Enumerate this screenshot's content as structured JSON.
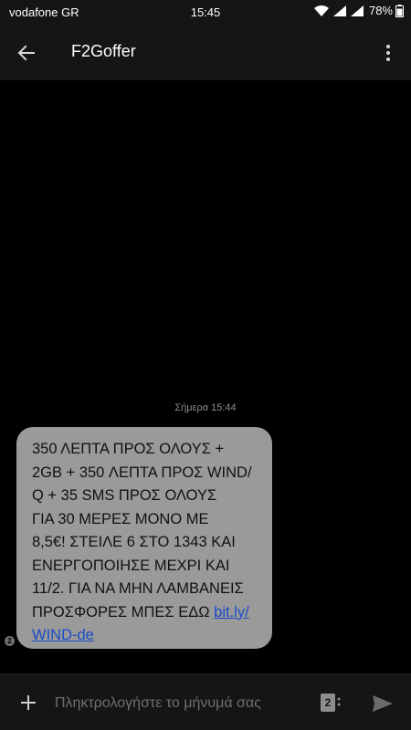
{
  "status_bar": {
    "carrier": "vodafone GR",
    "time": "15:45",
    "battery": "78%",
    "icons": [
      "wifi-icon",
      "signal-icon",
      "signal-icon",
      "battery-icon"
    ]
  },
  "app_bar": {
    "title": "F2Goffer",
    "back_icon": "back-arrow-icon",
    "menu_icon": "overflow-menu-icon"
  },
  "conversation": {
    "timestamp": "Σήμερα 15:44",
    "messages": [
      {
        "lines": [
          "350 ΛΕΠΤΑ ΠΡΟΣ ΟΛΟΥΣ +",
          "2GB + 350 ΛΕΠΤΑ ΠΡΟΣ WIND/",
          "Q + 35 SMS ΠΡΟΣ ΟΛΟΥΣ",
          "ΓΙΑ 30 ΜΕΡΕΣ ΜΟΝΟ ΜΕ",
          "8,5€! ΣΤΕΙΛΕ 6 ΣΤΟ 1343 ΚΑΙ",
          "ΕΝΕΡΓΟΠΟΙΗΣΕ ΜΕΧΡΙ ΚΑΙ",
          "11/2. ΓΙΑ ΝΑ ΜΗΝ ΛΑΜΒΑΝΕΙΣ",
          "ΠΡΟΣΦΟΡΕΣ ΜΠΕΣ ΕΔΩ "
        ],
        "link_part1": "bit.ly/",
        "link_part2": "WIND-de",
        "sim_badge": "2"
      }
    ]
  },
  "compose": {
    "placeholder": "Πληκτρολογήστε το μήνυμά σας",
    "sim_label": "2",
    "add_icon": "plus-icon",
    "send_icon": "send-icon"
  },
  "colors": {
    "background": "#000000",
    "bar": "#151515",
    "bubble": "#9a9a9a",
    "link": "#1a4cc7"
  }
}
